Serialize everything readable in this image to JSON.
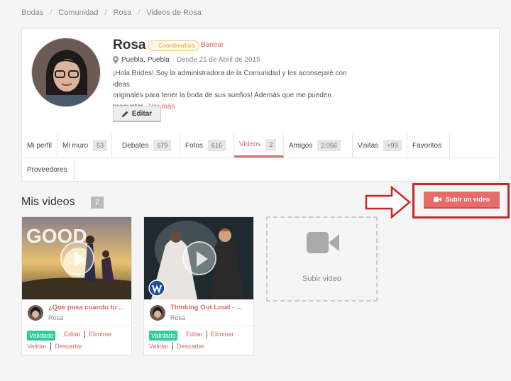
{
  "breadcrumb": [
    "Bodas",
    "Comunidad",
    "Rosa",
    "Videos de Rosa"
  ],
  "profile": {
    "name": "Rosa",
    "badge": "♡ Coordinadora",
    "ban_label": "Banear",
    "location": "Puebla, Puebla",
    "since": "Desde 21 de Abril de 2015",
    "bio_line1": "¡Hola Brides! Soy la administradora de la Comunidad y les aconsejaré con ideas",
    "bio_line2": "originales para tener la boda de sus sueños! Además que me pueden",
    "bio_line3": "preguntar...",
    "bio_more": "Ver más",
    "edit_label": "Editar"
  },
  "tabs": [
    {
      "label": "Mi perfil",
      "count": ""
    },
    {
      "label": "Mi muro",
      "count": "53"
    },
    {
      "label": "Debates",
      "count": "579"
    },
    {
      "label": "Fotos",
      "count": "616"
    },
    {
      "label": "Videos",
      "count": "2"
    },
    {
      "label": "Amigos",
      "count": "2.056"
    },
    {
      "label": "Visitas",
      "count": "+99"
    },
    {
      "label": "Favoritos",
      "count": ""
    },
    {
      "label": "Proveedores",
      "count": ""
    }
  ],
  "active_tab": "Videos",
  "section": {
    "title": "Mis videos",
    "count": "2"
  },
  "upload_label": "Subir un video",
  "videos": [
    {
      "title": "¿Que pasa cuando tu ...",
      "author": "Rosa",
      "status": "Validado",
      "actions_row1": [
        "Editar",
        "Eliminar"
      ],
      "actions_row2": [
        "Validar",
        "Descartar"
      ],
      "thumb_text": "GOOD"
    },
    {
      "title": "Thinking Out Loud - ...",
      "author": "Rosa",
      "status": "Validado",
      "actions_row1": [
        "Editar",
        "Eliminar"
      ],
      "actions_row2": [
        "Validar",
        "Descartar"
      ]
    }
  ],
  "add_video_label": "Subir video",
  "colors": {
    "accent": "#e86b6b",
    "validado": "#2ecc9a",
    "highlight_box": "#c62828"
  }
}
